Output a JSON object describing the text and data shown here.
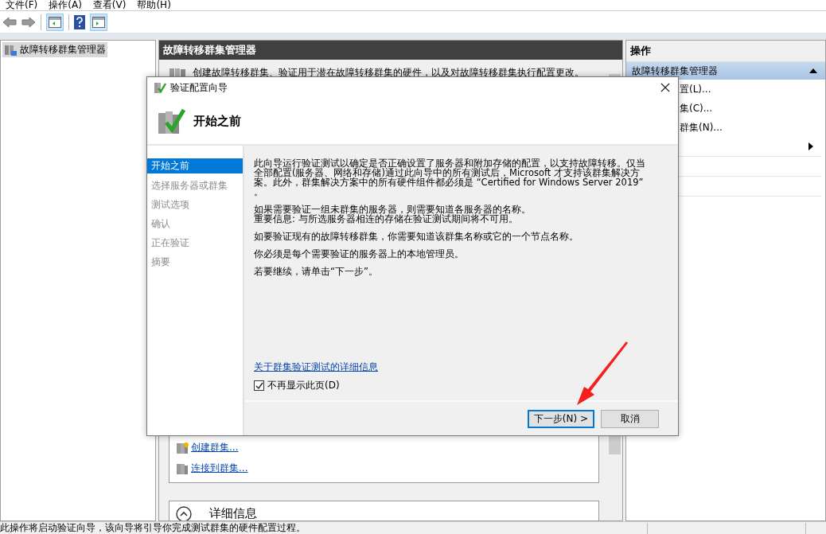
{
  "menu": [
    {
      "label": "文件(F)"
    },
    {
      "label": "操作(A)"
    },
    {
      "label": "查看(V)"
    },
    {
      "label": "帮助(H)"
    }
  ],
  "tree": [
    {
      "label": "故障转移群集管理器",
      "selected": true
    }
  ],
  "center": {
    "title": "故障转移群集管理器",
    "description": "创建故障转移群集、验证用于潜在故障转移群集的硬件，以及对故障转移群集执行配置更改。",
    "links": [
      {
        "label": "创建群集..."
      },
      {
        "label": "连接到群集..."
      }
    ],
    "details": {
      "label": "详细信息",
      "expanded": false
    }
  },
  "actions": {
    "title": "操作",
    "group": {
      "label": "故障转移群集管理器",
      "expanded": true
    },
    "items": [
      {
        "kind": "command",
        "label": "置(L)..."
      },
      {
        "kind": "command",
        "label": "集(C)..."
      },
      {
        "kind": "command",
        "label": "群集(N)..."
      },
      {
        "kind": "submenu"
      },
      {
        "kind": "empty"
      },
      {
        "kind": "empty"
      }
    ]
  },
  "status_bar": "此操作将启动验证向导，该向导将引导你完成测试群集的硬件配置过程。",
  "dialog": {
    "title": "验证配置向导",
    "heading": "开始之前",
    "steps": [
      {
        "label": "开始之前",
        "selected": true
      },
      {
        "label": "选择服务器或群集",
        "selected": false
      },
      {
        "label": "测试选项",
        "selected": false
      },
      {
        "label": "确认",
        "selected": false
      },
      {
        "label": "正在验证",
        "selected": false
      },
      {
        "label": "摘要",
        "selected": false
      }
    ],
    "paragraphs": [
      [
        "此向导运行验证测试以确定是否正确设置了服务器和附加存储的配置，以支持故障转移。仅当全部配置(服务器、网络和存储)通过此向导中的所有测试后，Microsoft 才支持该群集解决方案。此外，群集解决方案中的所有硬件组件都必须是 “Certified for Windows Server 2019” 。"
      ],
      [
        "如果需要验证一组未群集的服务器，则需要知道各服务器的名称。",
        "重要信息: 与所选服务器相连的存储在验证测试期间将不可用。"
      ],
      [
        "如要验证现有的故障转移群集，你需要知道该群集名称或它的一个节点名称。"
      ],
      [
        "你必须是每个需要验证的服务器上的本地管理员。"
      ],
      [
        "若要继续，请单击“下一步”。"
      ]
    ],
    "link": "关于群集验证测试的详细信息",
    "checkbox": {
      "label": "不再显示此页(D)",
      "checked": true
    },
    "buttons": [
      {
        "label": "下一步(N) >",
        "default": true
      },
      {
        "label": "取消",
        "default": false
      }
    ]
  }
}
